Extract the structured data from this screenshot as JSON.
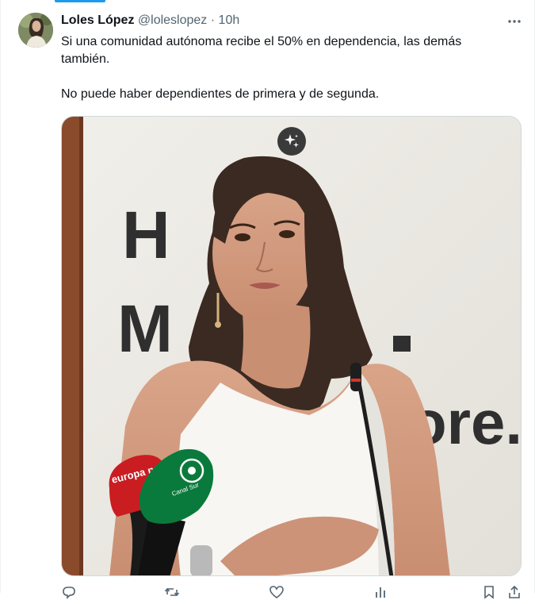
{
  "author": {
    "name": "Loles López",
    "handle": "@loleslopez",
    "separator": "·",
    "time": "10h"
  },
  "tweet": {
    "paragraphs": [
      "Si una comunidad autónoma recibe el 50% en dependencia, las demás también.",
      "No puede haber dependientes de primera y de segunda."
    ]
  },
  "media": {
    "backdrop_text_1": "H",
    "backdrop_text_2": "M",
    "backdrop_text_3": "ore.",
    "mic_left_brand": "europa press",
    "mic_right_brand": "Canal Sur"
  },
  "icons": {
    "more": "more-icon",
    "sparkle": "sparkle-icon",
    "reply": "reply-icon",
    "retweet": "retweet-icon",
    "like": "like-icon",
    "views": "views-icon",
    "bookmark": "bookmark-icon",
    "share": "share-icon"
  },
  "colors": {
    "accent": "#1d9bf0",
    "text": "#0f1419",
    "secondary": "#536471",
    "mic_red": "#c91d22",
    "mic_green": "#0a7a3c"
  }
}
